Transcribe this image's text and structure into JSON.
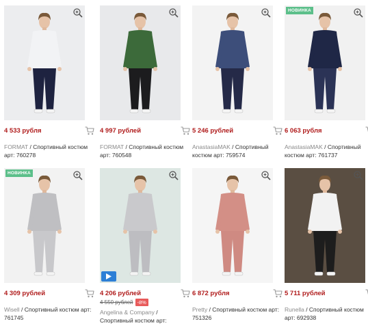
{
  "products": [
    {
      "price": "4 533 рубля",
      "brand": "FORMAT",
      "title": "Спортивный костюм арт: 760278",
      "badge": "",
      "colors": {
        "bg": "#ecedef",
        "top": "#f2f3f5",
        "bottom": "#1e2340"
      }
    },
    {
      "price": "4 997 рублей",
      "brand": "FORMAT",
      "title": "Спортивный костюм арт: 760548",
      "badge": "",
      "colors": {
        "bg": "#e8e9eb",
        "top": "#3c6a3a",
        "bottom": "#1c1c1e"
      }
    },
    {
      "price": "5 246 рублей",
      "brand": "AnastasiaMAK",
      "title": "Спортивный костюм арт: 759574",
      "badge": "",
      "colors": {
        "bg": "#f3f3f3",
        "top": "#3d4e7a",
        "bottom": "#252a48"
      }
    },
    {
      "price": "6 063 рубля",
      "brand": "AnastasiaMAK",
      "title": "Спортивный костюм арт: 761737",
      "badge": "НОВИНКА",
      "colors": {
        "bg": "#f1f1f1",
        "top": "#1f2746",
        "bottom": "#2b3356"
      }
    },
    {
      "price": "4 309 рублей",
      "brand": "Wisell",
      "title": "Спортивный костюм арт: 761745",
      "badge": "НОВИНКА",
      "colors": {
        "bg": "#f2f2f2",
        "top": "#bfbfc2",
        "bottom": "#c8c8cb"
      }
    },
    {
      "price": "4 206 рублей",
      "old_price": "4 550 рублей",
      "discount": "-8%",
      "brand": "Angelina & Company",
      "title": "Спортивный костюм арт:",
      "badge": "",
      "video": true,
      "colors": {
        "bg": "#dde7e3",
        "top": "#c9c9cc",
        "bottom": "#bdbdc1"
      }
    },
    {
      "price": "6 872 рубля",
      "brand": "Pretty",
      "title": "Спортивный костюм арт: 751326",
      "badge": "",
      "colors": {
        "bg": "#f5f5f5",
        "top": "#d38f86",
        "bottom": "#cf8a82"
      }
    },
    {
      "price": "5 711 рублей",
      "brand": "Runella",
      "title": "Спортивный костюм арт: 692938",
      "badge": "",
      "colors": {
        "bg": "#5a4e42",
        "top": "#f2f2f2",
        "bottom": "#1d1d1d"
      }
    }
  ],
  "colors": {
    "price": "#b01c1c",
    "badge": "#5cbf8a",
    "discount": "#e85a5a",
    "play": "#2d7fd6",
    "brand": "#8a8a8a"
  },
  "icons": {
    "zoom": "zoom-in-icon",
    "cart": "cart-icon",
    "play": "play-icon"
  }
}
